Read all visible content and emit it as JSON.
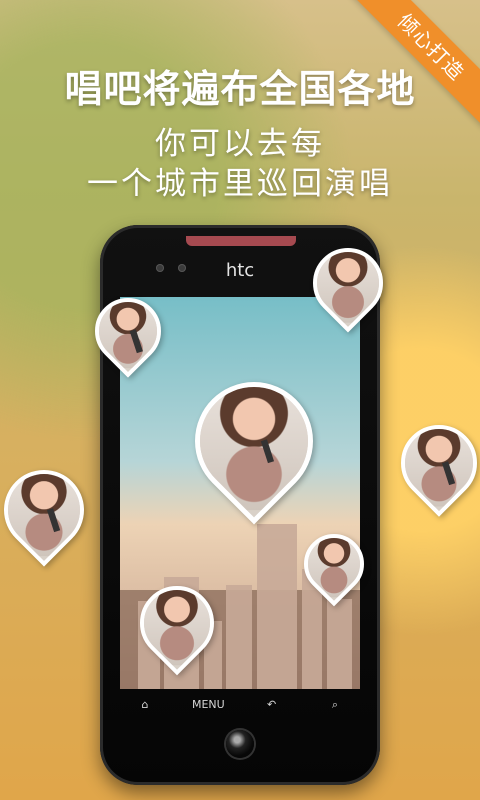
{
  "ribbon": "倾心打造",
  "headline": "唱吧将遍布全国各地",
  "subline1": "你可以去每",
  "subline2": "一个城市里巡回演唱",
  "phone": {
    "brand": "htc",
    "softkeys": [
      "⌂",
      "MENU",
      "↶",
      "⌕"
    ]
  }
}
